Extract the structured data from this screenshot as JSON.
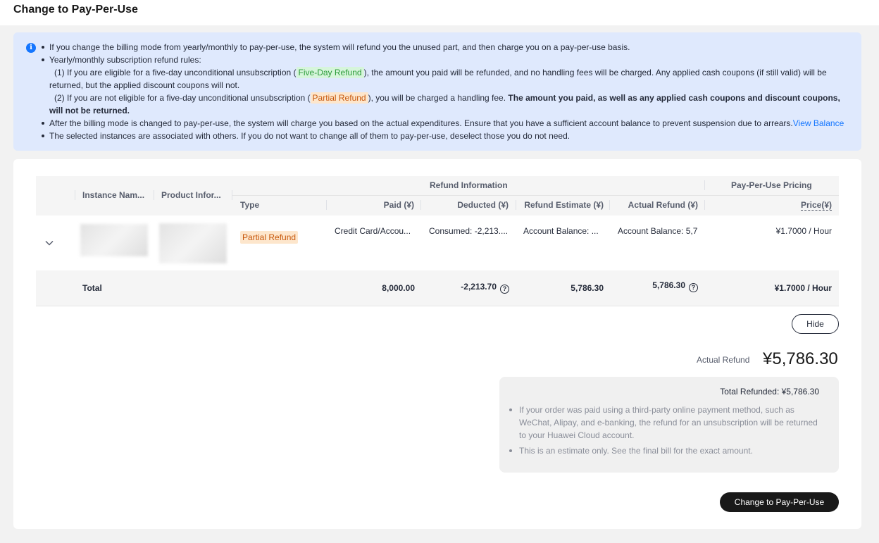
{
  "page": {
    "title": "Change to Pay-Per-Use"
  },
  "info": {
    "line1": "If you change the billing mode from yearly/monthly to pay-per-use, the system will refund you the unused part, and then charge you on a pay-per-use basis.",
    "line2": "Yearly/monthly subscription refund rules:",
    "rule1_pre": "(1)  If you are eligible for a five-day unconditional unsubscription (",
    "rule1_tag": "Five-Day Refund",
    "rule1_post": "), the amount you paid will be refunded, and no handling fees will be charged. Any applied cash coupons (if still valid) will be",
    "rule1_cont": "returned, but the applied discount coupons will not.",
    "rule2_pre": "(2)  If you are not eligible for a five-day unconditional unsubscription (",
    "rule2_tag": "Partial Refund",
    "rule2_post": "), you will be charged a handling fee.",
    "rule2_bold": "The amount you paid, as well as any applied cash coupons and discount coupons,",
    "rule2_bold_cont": "will not be returned.",
    "line3": "After the billing mode is changed to pay-per-use, the system will charge you based on the actual expenditures. Ensure that you have a sufficient account balance to prevent suspension due to arrears.",
    "line3_link": "View Balance",
    "line4": "The selected instances are associated with others. If you do not want to change all of them to pay-per-use, deselect those you do not need."
  },
  "table": {
    "group_refund": "Refund Information",
    "group_pricing": "Pay-Per-Use Pricing",
    "headers": {
      "instance": "Instance Nam...",
      "product": "Product Infor...",
      "type": "Type",
      "paid": "Paid (¥)",
      "deducted": "Deducted (¥)",
      "estimate": "Refund Estimate (¥)",
      "actual": "Actual Refund (¥)",
      "price": "Price(¥)"
    },
    "row": {
      "type": "Partial Refund",
      "paid": "Credit Card/Accou...",
      "deducted": "Consumed: -2,213....",
      "estimate": "Account Balance: ...",
      "actual": "Account Balance: 5,7",
      "price": "¥1.7000 / Hour"
    },
    "total": {
      "label": "Total",
      "paid": "8,000.00",
      "deducted": "-2,213.70",
      "estimate": "5,786.30",
      "actual": "5,786.30",
      "price": "¥1.7000 / Hour"
    }
  },
  "summary": {
    "hide_label": "Hide",
    "refund_label": "Actual Refund",
    "refund_amount": "¥5,786.30",
    "total_refunded": "Total Refunded: ¥5,786.30",
    "note1_l1": "If your order was paid using a third-party online payment method, such as",
    "note1_l2": "WeChat, Alipay, and e-banking, the refund for an unsubscription will be returned",
    "note1_l3": "to your Huawei Cloud account.",
    "note2": "This is an estimate only. See the final bill for the exact amount.",
    "submit_label": "Change to Pay-Per-Use"
  },
  "icons": {
    "info": "info-icon",
    "chevron": "chevron-down-icon",
    "help": "question-circle-icon"
  },
  "colors": {
    "info_bg": "#dfe9fd",
    "accent": "#1476ff",
    "primary_button": "#191919",
    "tag_green": "#2c9b3a",
    "tag_orange": "#c7580c"
  }
}
